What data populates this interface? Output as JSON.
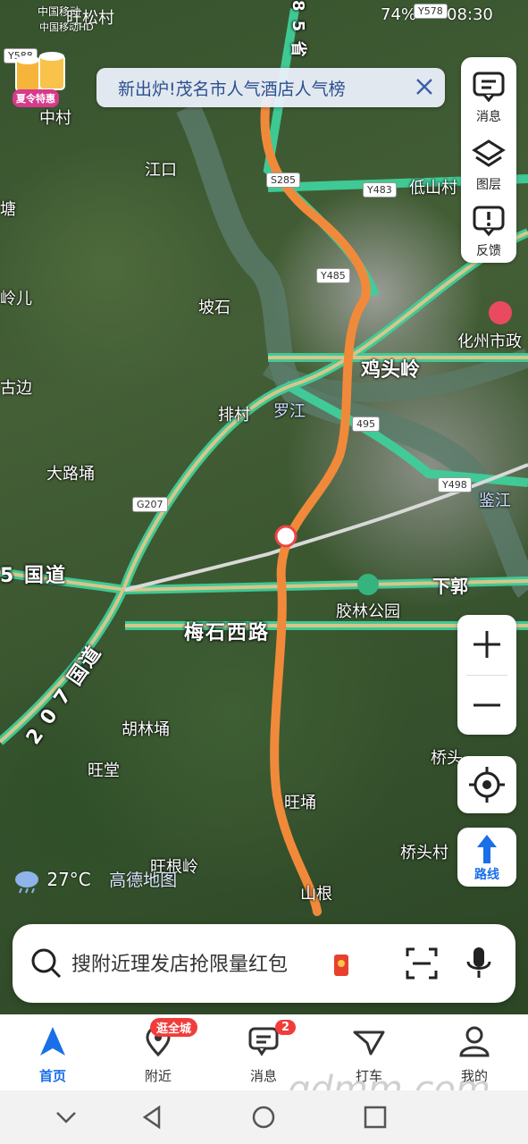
{
  "status": {
    "time": "08:30",
    "battery": "74%",
    "carrier_top": "中国移动",
    "carrier_sub": "中国移动HD"
  },
  "banner": {
    "text": "新出炉!茂名市人气酒店人气榜"
  },
  "promo": {
    "tag": "夏令特惠"
  },
  "side_panel": {
    "items": [
      {
        "label": "消息",
        "icon": "message-icon"
      },
      {
        "label": "图层",
        "icon": "layers-icon"
      },
      {
        "label": "反馈",
        "icon": "feedback-icon"
      }
    ]
  },
  "map": {
    "places": {
      "wangsongcun": "旺松村",
      "zhongcun": "中村",
      "jiangkou": "江口",
      "dishancun": "低山村",
      "tang": "塘",
      "linger": "岭儿",
      "poshi": "坡石",
      "huazhoushizheng": "化州市政",
      "jitouling": "鸡头岭",
      "bian": "古边",
      "paicun": "排村",
      "luojiang": "罗江",
      "dalubu": "大路埇",
      "jiaolingongyuan": "胶林公园",
      "xiaguo": "下郭",
      "huliyong": "胡林埇",
      "qiaotou": "桥头",
      "wangtang": "旺堂",
      "wangyong": "旺埇",
      "qiaotoucun": "桥头村",
      "wanggenling": "旺根岭",
      "shangen": "山根",
      "jianjiang": "鉴江"
    },
    "roads": {
      "meishi": "梅石西路",
      "g207": "2 0 7 国道",
      "g325": "5 国道",
      "sheng": "8 5 省"
    },
    "shields": {
      "y578": "Y578",
      "y588": "Y588",
      "s285": "S285",
      "y483": "Y483",
      "y485": "Y485",
      "y495": "495",
      "y498": "Y498",
      "g207": "G207"
    }
  },
  "weather": {
    "temp": "27°C",
    "provider": "高德地图"
  },
  "search": {
    "placeholder": "搜附近理发店抢限量红包"
  },
  "tabs": [
    {
      "label": "首页"
    },
    {
      "label": "附近",
      "badge": "逛全城"
    },
    {
      "label": "消息",
      "badge": "2"
    },
    {
      "label": "打车"
    },
    {
      "label": "我的"
    }
  ],
  "route_button": {
    "label": "路线"
  },
  "watermark": "gdmm.com",
  "colors": {
    "accent": "#1a6fe8",
    "route": "#f08a3a",
    "road": "#3fcf9a",
    "badge": "#f23c3c"
  }
}
